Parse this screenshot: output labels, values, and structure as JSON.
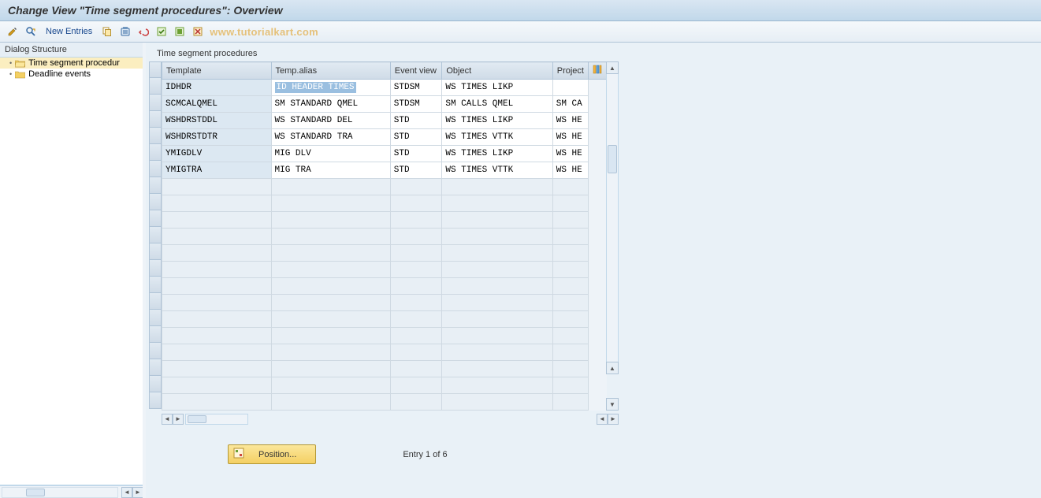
{
  "title": "Change View \"Time segment procedures\": Overview",
  "toolbar": {
    "new_entries": "New Entries"
  },
  "watermark": "www.tutorialkart.com",
  "sidebar": {
    "title": "Dialog Structure",
    "items": [
      {
        "label": "Time segment procedur",
        "active": true
      },
      {
        "label": "Deadline events",
        "active": false
      }
    ]
  },
  "panel": {
    "title": "Time segment procedures",
    "columns": [
      "Template",
      "Temp.alias",
      "Event view",
      "Object",
      "Project"
    ],
    "rows": [
      {
        "template": "IDHDR",
        "alias": "ID HEADER TIMES",
        "event": "STDSM",
        "object": "WS TIMES LIKP",
        "project": ""
      },
      {
        "template": "SCMCALQMEL",
        "alias": "SM STANDARD     QMEL",
        "event": "STDSM",
        "object": "SM CALLS QMEL",
        "project": "SM CA"
      },
      {
        "template": "WSHDRSTDDL",
        "alias": "WS STANDARD DEL",
        "event": "STD",
        "object": "WS TIMES LIKP",
        "project": "WS HE"
      },
      {
        "template": "WSHDRSTDTR",
        "alias": "WS STANDARD TRA",
        "event": "STD",
        "object": "WS TIMES VTTK",
        "project": "WS HE"
      },
      {
        "template": "YMIGDLV",
        "alias": "MIG DLV",
        "event": "STD",
        "object": "WS TIMES LIKP",
        "project": "WS HE"
      },
      {
        "template": "YMIGTRA",
        "alias": "MIG TRA",
        "event": "STD",
        "object": "WS TIMES VTTK",
        "project": "WS HE"
      }
    ],
    "empty_rows": 14
  },
  "bottom": {
    "position_label": "Position...",
    "entry_text": "Entry 1 of 6"
  }
}
